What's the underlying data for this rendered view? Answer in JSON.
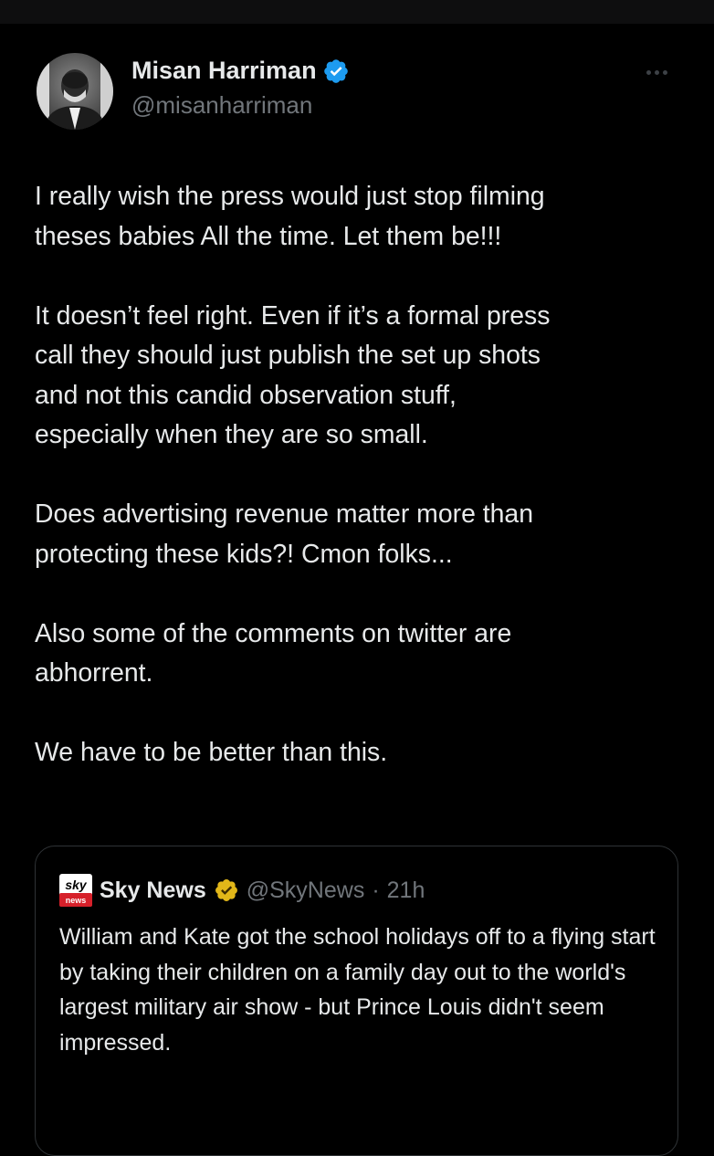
{
  "tweet": {
    "author": {
      "name": "Misan Harriman",
      "handle": "@misanharriman"
    },
    "paragraphs": [
      "I really wish the press would just stop filming\ntheses babies All the time.  Let them be!!!",
      "It doesn’t feel right.  Even if it’s a formal press\ncall they should just publish the set up shots\nand not this candid observation stuff,\nespecially when they are so small.",
      "Does advertising revenue matter more than\nprotecting these kids?! Cmon folks...",
      "Also some of the comments on twitter are\nabhorrent.",
      "We have to be better than this."
    ]
  },
  "quoted": {
    "logo_text_top": "sky",
    "logo_text_bottom": "news",
    "name": "Sky News",
    "handle": "@SkyNews",
    "separator": "·",
    "time": "21h",
    "text": "William and Kate got the school holidays off to a flying start by taking their children on a family day out to the world's largest military air show - but Prince Louis didn't seem impressed."
  },
  "colors": {
    "background": "#000000",
    "text": "#e7e9ea",
    "muted": "#71767b",
    "verified_blue": "#1d9bf0",
    "verified_gold": "#e2b719",
    "sky_red": "#d6202a"
  },
  "icons": {
    "verified": "verified-check-icon",
    "more": "more-horizontal-icon",
    "gold_verified": "gold-verified-icon"
  }
}
